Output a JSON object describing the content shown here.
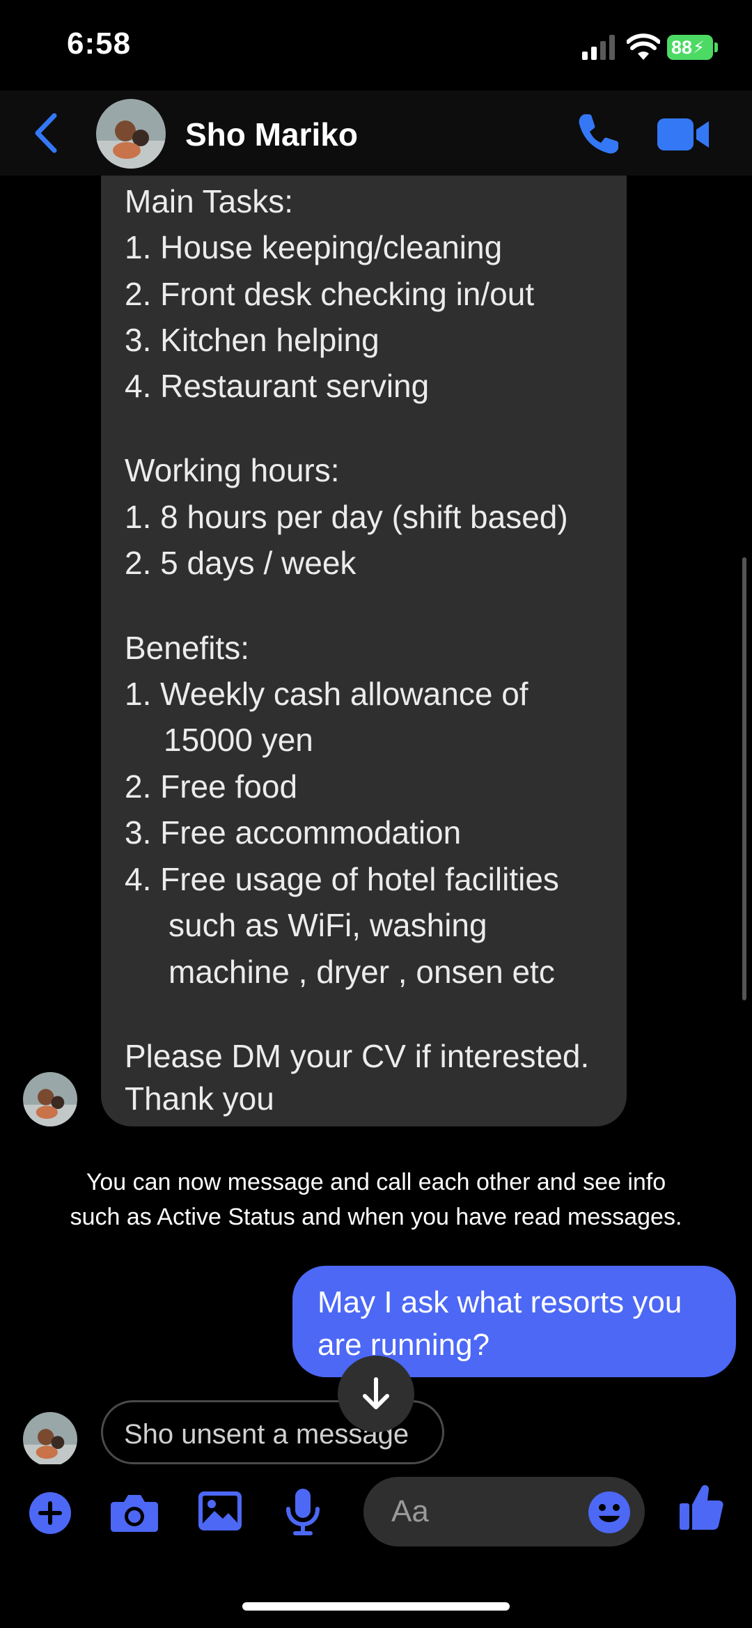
{
  "status_bar": {
    "time": "6:58",
    "battery": "88"
  },
  "header": {
    "contact_name": "Sho Mariko"
  },
  "incoming_message": {
    "lines": [
      "Main Tasks:",
      "1.  House keeping/cleaning",
      "2.  Front desk checking in/out",
      "3.  Kitchen helping",
      "4.  Restaurant serving",
      "Working hours:",
      "1.  8 hours per day (shift based)",
      "2.  5 days / week",
      "Benefits:",
      "1.  Weekly cash allowance of",
      "15000 yen",
      "2.  Free food",
      "3.  Free accommodation",
      "4.  Free usage of hotel facilities",
      "such as WiFi, washing",
      "machine , dryer , onsen etc",
      "Please DM your CV if interested.",
      "Thank you"
    ]
  },
  "info_notice": {
    "line1": "You can now message and call each other and see info",
    "line2": "such as Active Status and when you have read messages."
  },
  "outgoing_message": {
    "line1": "May I ask what resorts you",
    "line2": "are running?"
  },
  "unsent_notice": "Sho unsent a message",
  "composer": {
    "placeholder": "Aa"
  },
  "colors": {
    "accent": "#3478f6",
    "outgoing_bubble": "#4c68f5",
    "incoming_bubble": "#2f2f2f",
    "battery": "#4cd964"
  }
}
